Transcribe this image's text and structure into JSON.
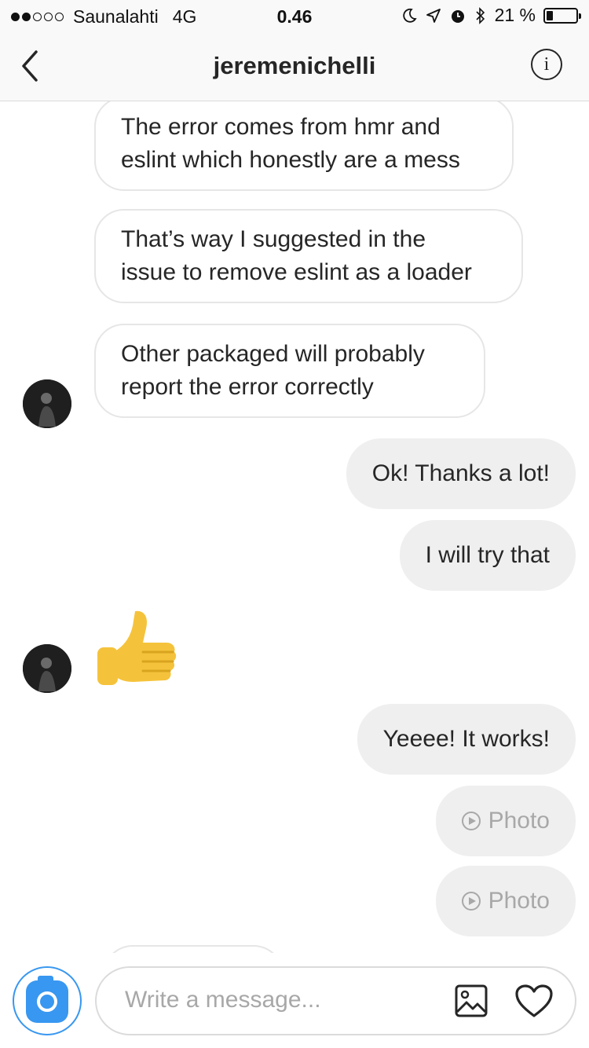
{
  "status_bar": {
    "carrier": "Saunalahti",
    "network": "4G",
    "time": "0.46",
    "battery": "21 %",
    "battery_level": 0.21,
    "signal_bars_filled": 2,
    "signal_bars_total": 5
  },
  "header": {
    "title": "jeremenichelli",
    "back_icon": "chevron-left-icon",
    "info_icon": "info-icon",
    "info_glyph": "i"
  },
  "messages": [
    {
      "direction": "in",
      "text_line1": "The error comes from hmr and",
      "text_line2": "eslint which honestly are a mess"
    },
    {
      "direction": "in",
      "text_line1": "That’s way I suggested in the",
      "text_line2": "issue to remove eslint as a loader"
    },
    {
      "direction": "in",
      "text_line1": "Other packaged will probably",
      "text_line2": "report the error correctly"
    },
    {
      "direction": "out",
      "text": "Ok! Thanks a lot!"
    },
    {
      "direction": "out",
      "text": "I will try that"
    },
    {
      "direction": "in",
      "emoji": "thumbs-up"
    },
    {
      "direction": "out",
      "text": "Yeeee! It works!"
    },
    {
      "direction": "out",
      "text": "Photo",
      "icon": "play-icon"
    },
    {
      "direction": "out",
      "text": "Photo",
      "icon": "play-icon"
    }
  ],
  "composer": {
    "placeholder": "Write a message...",
    "camera_icon": "camera-icon",
    "gallery_icon": "gallery-icon",
    "like_icon": "heart-icon"
  },
  "colors": {
    "accent": "#3897f0",
    "outgoing_bubble": "#efefef",
    "incoming_border": "#e6e6e6",
    "placeholder": "#a8a8a8",
    "thumb": "#f5c33b"
  }
}
